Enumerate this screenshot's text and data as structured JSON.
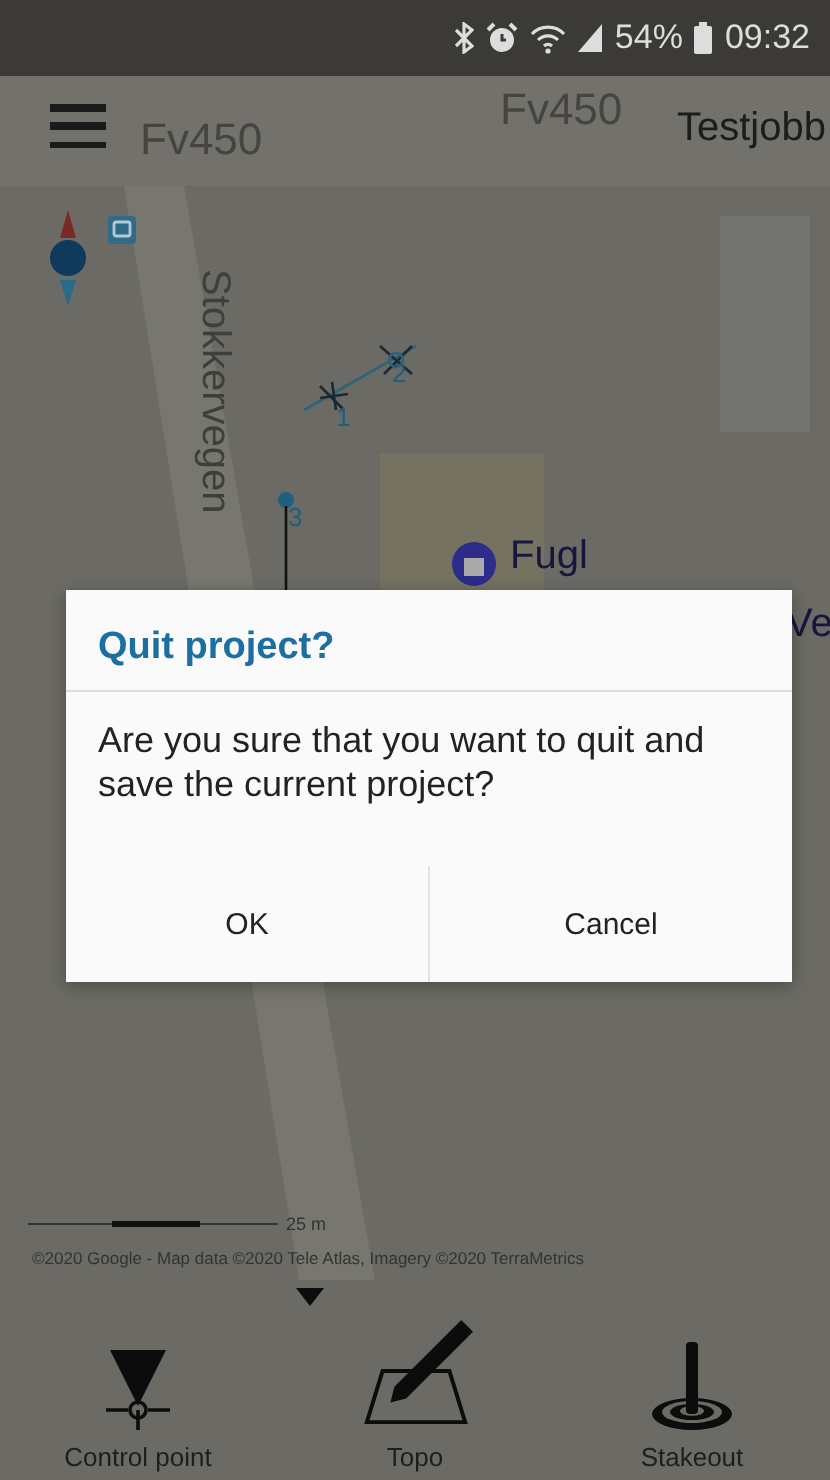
{
  "status_bar": {
    "battery": "54%",
    "time": "09:32"
  },
  "app_bar": {
    "title": "Testjobb",
    "map_labels": [
      "Fv450",
      "Fv450"
    ]
  },
  "map": {
    "road_label": "Stokkervegen",
    "labels": [
      "Fugl",
      "Ve"
    ],
    "points": [
      "1",
      "2",
      "3"
    ],
    "scale": "25 m",
    "attribution": "©2020 Google - Map data ©2020 Tele Atlas, Imagery ©2020 TerraMetrics"
  },
  "dialog": {
    "title": "Quit project?",
    "message": "Are you sure that you want to quit and save the current project?",
    "buttons": [
      "OK",
      "Cancel"
    ]
  },
  "toolbar": {
    "items": [
      {
        "label": "Control point",
        "kind": "control-point"
      },
      {
        "label": "Topo",
        "kind": "topo"
      },
      {
        "label": "Stakeout",
        "kind": "stakeout"
      }
    ]
  }
}
